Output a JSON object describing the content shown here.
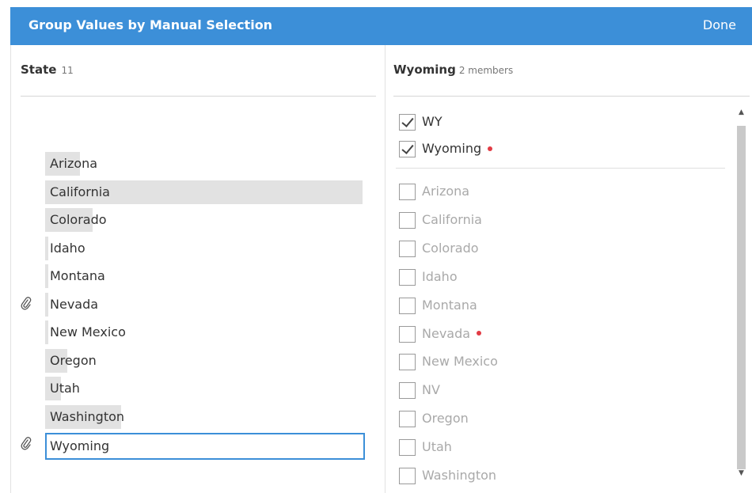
{
  "header": {
    "title": "Group Values by Manual Selection",
    "done_label": "Done"
  },
  "left": {
    "field_name": "State",
    "count": "11",
    "values": [
      {
        "label": "Arizona",
        "bar_fraction": 0.11,
        "grouped": false
      },
      {
        "label": "California",
        "bar_fraction": 1.0,
        "grouped": false
      },
      {
        "label": "Colorado",
        "bar_fraction": 0.15,
        "grouped": false
      },
      {
        "label": "Idaho",
        "bar_fraction": 0.01,
        "grouped": false
      },
      {
        "label": "Montana",
        "bar_fraction": 0.01,
        "grouped": false
      },
      {
        "label": "Nevada",
        "bar_fraction": 0.01,
        "grouped": true
      },
      {
        "label": "New Mexico",
        "bar_fraction": 0.01,
        "grouped": false
      },
      {
        "label": "Oregon",
        "bar_fraction": 0.07,
        "grouped": false
      },
      {
        "label": "Utah",
        "bar_fraction": 0.05,
        "grouped": false
      },
      {
        "label": "Washington",
        "bar_fraction": 0.24,
        "grouped": false
      },
      {
        "label": "Wyoming",
        "bar_fraction": 0,
        "grouped": true,
        "selected": true
      }
    ]
  },
  "right": {
    "group_name": "Wyoming",
    "members_label": "2 members",
    "checked_members": [
      {
        "label": "WY",
        "dot": false
      },
      {
        "label": "Wyoming",
        "dot": true
      }
    ],
    "unchecked_members": [
      {
        "label": "Arizona",
        "dot": false
      },
      {
        "label": "California",
        "dot": false
      },
      {
        "label": "Colorado",
        "dot": false
      },
      {
        "label": "Idaho",
        "dot": false
      },
      {
        "label": "Montana",
        "dot": false
      },
      {
        "label": "Nevada",
        "dot": true
      },
      {
        "label": "New Mexico",
        "dot": false
      },
      {
        "label": "NV",
        "dot": false
      },
      {
        "label": "Oregon",
        "dot": false
      },
      {
        "label": "Utah",
        "dot": false
      },
      {
        "label": "Washington",
        "dot": false
      }
    ]
  },
  "colors": {
    "header_bg": "#3c8fd8",
    "selection_border": "#3c8fd8",
    "dot": "#e23b44",
    "bar": "#e2e2e2"
  },
  "icons": {
    "grouped_marker": "paperclip-icon",
    "scroll_up": "triangle-up-icon",
    "scroll_down": "triangle-down-icon"
  }
}
